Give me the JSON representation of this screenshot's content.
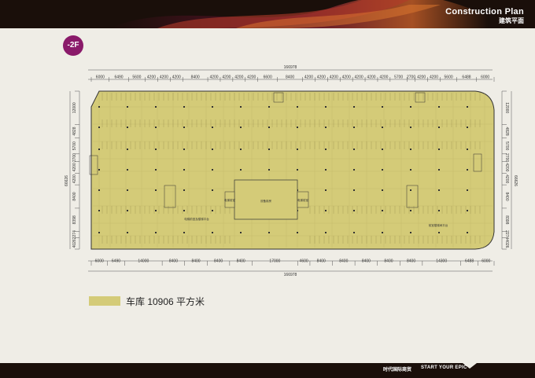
{
  "header": {
    "title": "Construction Plan",
    "subtitle": "建筑平面"
  },
  "floor_badge": "-2F",
  "plan": {
    "overall_width": "166978",
    "top_dims": [
      "6000",
      "6490",
      "5600",
      "4200",
      "4200",
      "4200",
      "8400",
      "4200",
      "4200",
      "4200",
      "4200",
      "6600",
      "8400",
      "4200",
      "4200",
      "4200",
      "4200",
      "4200",
      "4200",
      "4200",
      "5700",
      "2700",
      "4200",
      "4200",
      "5600",
      "6488",
      "6000"
    ],
    "bottom_dims": [
      "6000",
      "6490",
      "14000",
      "8400",
      "8400",
      "8400",
      "8400",
      "17000",
      "4600",
      "8400",
      "8400",
      "8400",
      "8400",
      "8400",
      "14300",
      "6488",
      "6000"
    ],
    "left_dims": [
      "12000",
      "4828",
      "5700",
      "2700",
      "4200",
      "4200",
      "8400",
      "8398",
      "2274",
      "4026"
    ],
    "right_dims": [
      "12000",
      "4828",
      "5700",
      "2700",
      "4200",
      "4200",
      "8400",
      "8398",
      "2274",
      "4026"
    ],
    "side_total": "66626",
    "rooms": {
      "center": "设备用房",
      "left_label": "电梯前室",
      "right_label": "电梯前室",
      "left_zone": "电梯前室及楼梯平台",
      "right_zone": "前室楼梯间平台"
    }
  },
  "legend": {
    "color": "#d4cb78",
    "label": "车库 10906 平方米"
  },
  "footer": {
    "brand": "时代国际商贸",
    "slogan": "START YOUR EPIC"
  }
}
